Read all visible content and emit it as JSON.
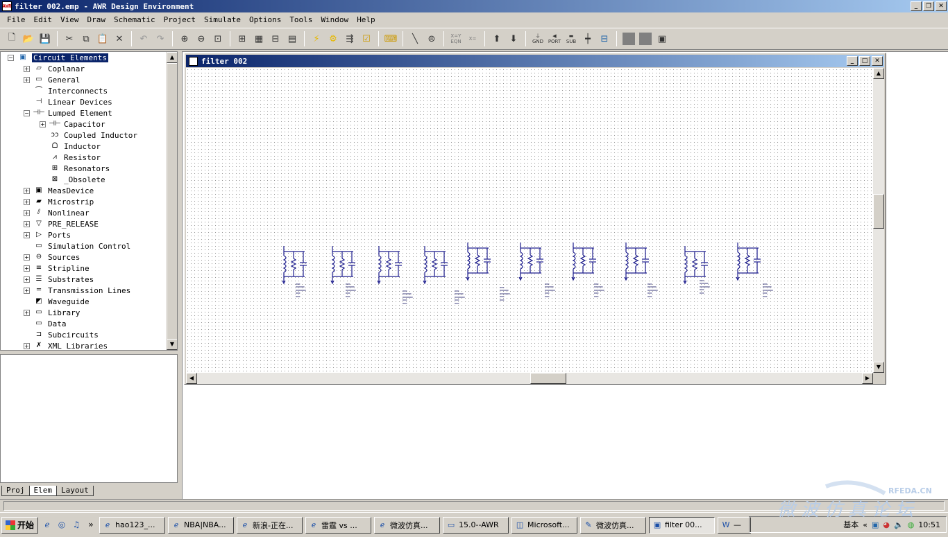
{
  "window": {
    "title": "filter 002.emp - AWR Design Environment",
    "app_icon": "AWR"
  },
  "menu": [
    "File",
    "Edit",
    "View",
    "Draw",
    "Schematic",
    "Project",
    "Simulate",
    "Options",
    "Tools",
    "Window",
    "Help"
  ],
  "toolbar": {
    "icons": [
      "new-icon",
      "open-icon",
      "save-icon",
      "cut-icon",
      "copy-icon",
      "paste-icon",
      "delete-icon",
      "undo-icon",
      "redo-icon",
      "zoom-in-icon",
      "zoom-out-icon",
      "view-all-icon",
      "add-schematic-icon",
      "add-graph-icon",
      "add-measurement-icon",
      "add-layout-icon",
      "simulate-icon",
      "tune-icon",
      "optimize-icon",
      "yield-icon",
      "scripts-icon",
      "wire-icon",
      "element-icon",
      "equation-icon",
      "variable-icon",
      "up-icon",
      "down-icon",
      "gnd-icon",
      "port-icon",
      "sub-icon",
      "bus-icon",
      "layer1-icon",
      "layer2-icon",
      "layer3-icon"
    ],
    "eqn_label": "X=Y\nEQN",
    "var_label": "X=",
    "gnd_label": "GND",
    "port_label": "PORT",
    "sub_label": "SUB"
  },
  "tree": {
    "root": "Circuit Elements",
    "items": [
      {
        "label": "Coplanar",
        "level": 1,
        "expander": "+",
        "icon": "coplanar-icon"
      },
      {
        "label": "General",
        "level": 1,
        "expander": "+",
        "icon": "general-icon"
      },
      {
        "label": "Interconnects",
        "level": 1,
        "expander": "",
        "icon": "interconnect-icon"
      },
      {
        "label": "Linear Devices",
        "level": 1,
        "expander": "",
        "icon": "linear-device-icon"
      },
      {
        "label": "Lumped Element",
        "level": 1,
        "expander": "-",
        "icon": "lumped-icon"
      },
      {
        "label": "Capacitor",
        "level": 2,
        "expander": "+",
        "icon": "capacitor-icon"
      },
      {
        "label": "Coupled Inductor",
        "level": 2,
        "expander": "",
        "icon": "coupled-inductor-icon"
      },
      {
        "label": "Inductor",
        "level": 2,
        "expander": "",
        "icon": "inductor-icon"
      },
      {
        "label": "Resistor",
        "level": 2,
        "expander": "",
        "icon": "resistor-icon"
      },
      {
        "label": "Resonators",
        "level": 2,
        "expander": "",
        "icon": "resonator-icon"
      },
      {
        "label": "_Obsolete",
        "level": 2,
        "expander": "",
        "icon": "obsolete-icon"
      },
      {
        "label": "MeasDevice",
        "level": 1,
        "expander": "+",
        "icon": "measdevice-icon"
      },
      {
        "label": "Microstrip",
        "level": 1,
        "expander": "+",
        "icon": "microstrip-icon"
      },
      {
        "label": "Nonlinear",
        "level": 1,
        "expander": "+",
        "icon": "nonlinear-icon"
      },
      {
        "label": "PRE_RELEASE",
        "level": 1,
        "expander": "+",
        "icon": "pre-release-icon"
      },
      {
        "label": "Ports",
        "level": 1,
        "expander": "+",
        "icon": "port-icon"
      },
      {
        "label": "Simulation Control",
        "level": 1,
        "expander": "",
        "icon": "sim-control-icon"
      },
      {
        "label": "Sources",
        "level": 1,
        "expander": "+",
        "icon": "source-icon"
      },
      {
        "label": "Stripline",
        "level": 1,
        "expander": "+",
        "icon": "stripline-icon"
      },
      {
        "label": "Substrates",
        "level": 1,
        "expander": "+",
        "icon": "substrate-icon"
      },
      {
        "label": "Transmission Lines",
        "level": 1,
        "expander": "+",
        "icon": "tline-icon"
      },
      {
        "label": "Waveguide",
        "level": 1,
        "expander": "",
        "icon": "waveguide-icon"
      },
      {
        "label": "Library",
        "level": 1,
        "expander": "+",
        "icon": "folder-icon"
      },
      {
        "label": "Data",
        "level": 1,
        "expander": "",
        "icon": "folder-icon"
      },
      {
        "label": "Subcircuits",
        "level": 1,
        "expander": "",
        "icon": "subcircuit-icon"
      },
      {
        "label": "XML Libraries",
        "level": 1,
        "expander": "+",
        "icon": "xml-icon"
      }
    ]
  },
  "panel_tabs": [
    "Proj",
    "Elem",
    "Layout"
  ],
  "active_panel_tab": "Elem",
  "document": {
    "title": "filter 002"
  },
  "taskbar": {
    "start": "开始",
    "tasks": [
      {
        "label": "hao123_...",
        "icon": "ie-icon"
      },
      {
        "label": "NBA|NBA...",
        "icon": "ie-icon"
      },
      {
        "label": "新浪-正在...",
        "icon": "ie-icon"
      },
      {
        "label": "雷霆 vs ...",
        "icon": "ie-icon"
      },
      {
        "label": "微波仿真...",
        "icon": "ie-icon"
      },
      {
        "label": "15.0--AWR",
        "icon": "folder-icon"
      },
      {
        "label": "Microsoft...",
        "icon": "office-icon"
      },
      {
        "label": "微波仿真...",
        "icon": "notepad-icon"
      },
      {
        "label": "filter 00...",
        "icon": "awr-icon"
      },
      {
        "label": "—",
        "icon": "word-icon"
      }
    ],
    "active_task": 8,
    "ime": "基本",
    "clock": "10:51"
  },
  "colors": {
    "titlebar": "#0a246a",
    "schematic": "#1a1a8c",
    "face": "#d4d0c8"
  }
}
